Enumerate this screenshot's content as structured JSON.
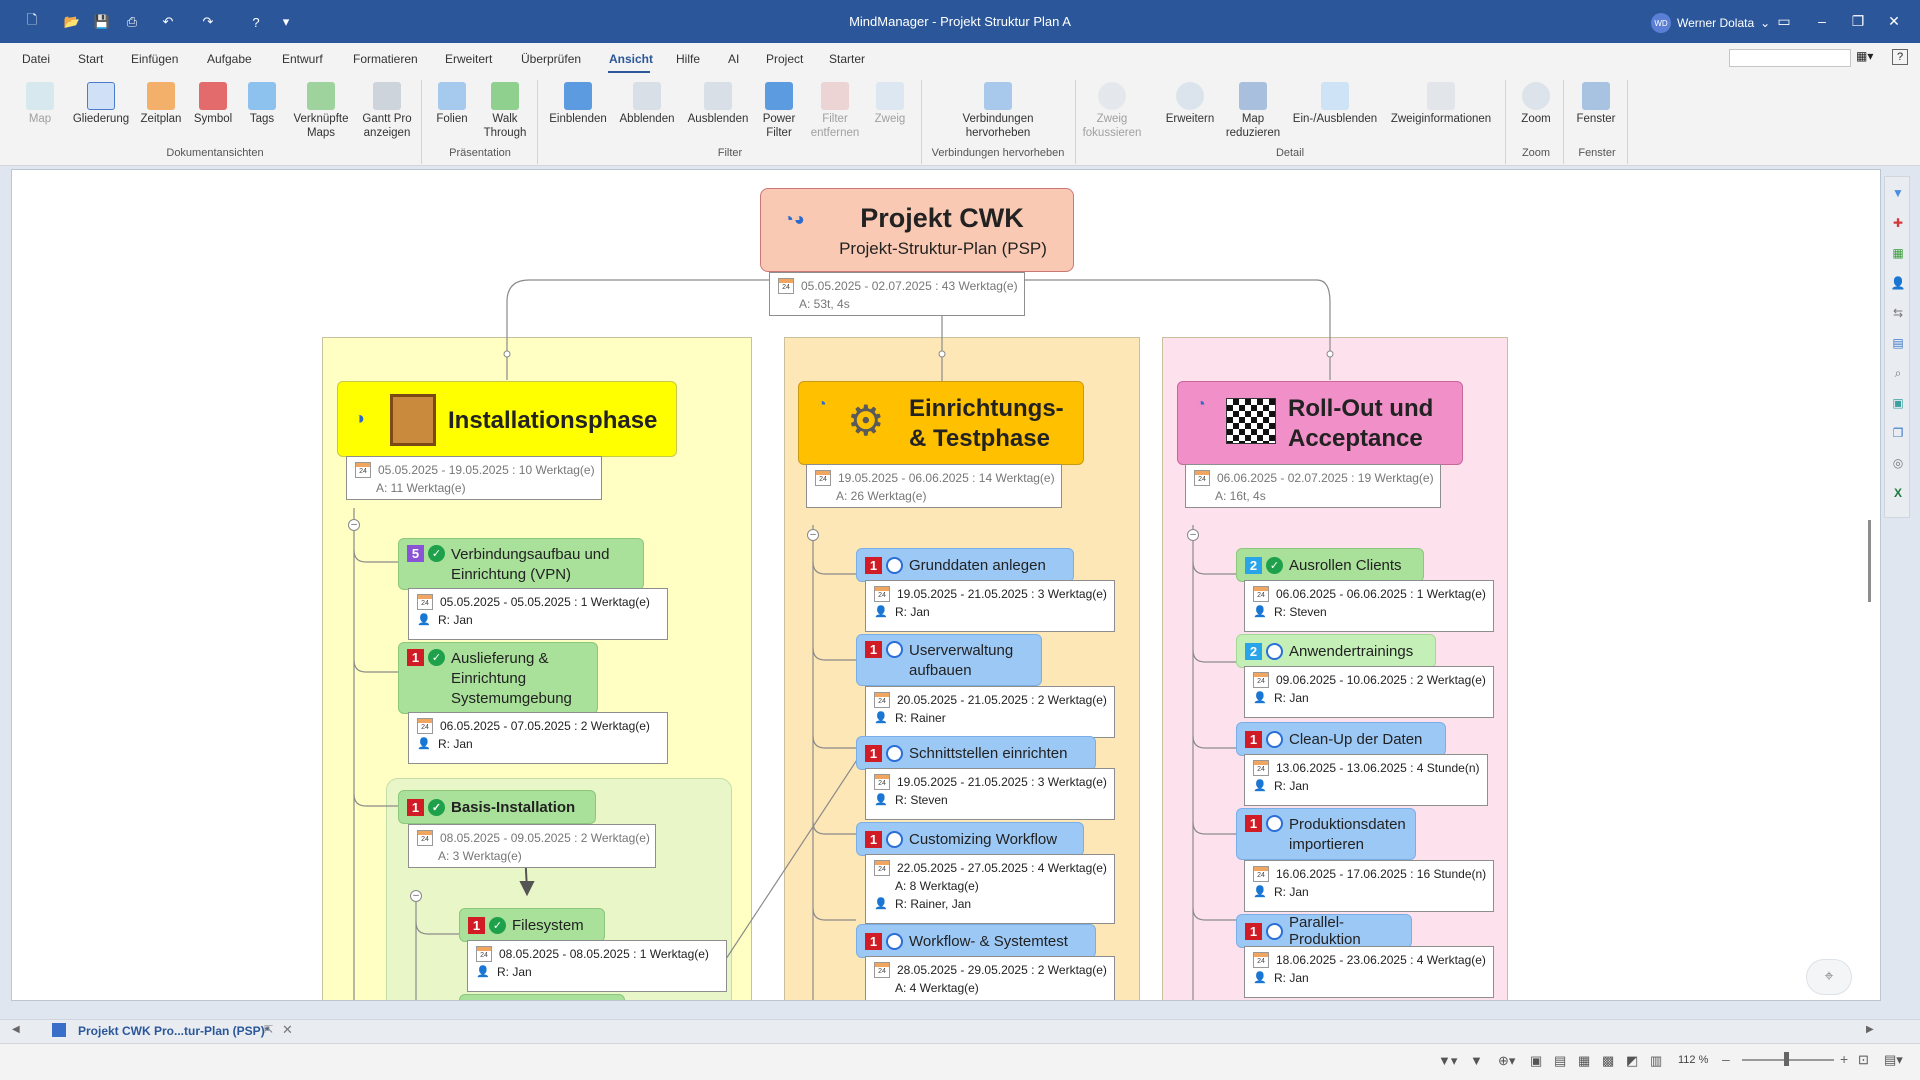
{
  "app": {
    "title": "MindManager - Projekt Struktur Plan A",
    "user": "Werner Dolata",
    "user_initials": "WD"
  },
  "menu": [
    "Datei",
    "Start",
    "Einfügen",
    "Aufgabe",
    "Entwurf",
    "Formatieren",
    "Erweitert",
    "Überprüfen",
    "Ansicht",
    "Hilfe",
    "AI",
    "Project",
    "Starter"
  ],
  "menu_active": "Ansicht",
  "ribbon": {
    "buttons": {
      "map": "Map",
      "gliederung": "Gliederung",
      "zeitplan": "Zeitplan",
      "symbol": "Symbol",
      "tags": "Tags",
      "verknuepfte": "Verknüpfte Maps",
      "gantt": "Gantt Pro anzeigen",
      "folien": "Folien",
      "walk": "Walk Through",
      "einblenden": "Einblenden",
      "abblenden": "Abblenden",
      "ausblenden": "Ausblenden",
      "power": "Power Filter",
      "filter_entfernen": "Filter entfernen",
      "zweig": "Zweig",
      "verbindungen": "Verbindungen hervorheben",
      "zweig_fokus": "Zweig fokussieren",
      "erweitern": "Erweitern",
      "map_reduzieren": "Map reduzieren",
      "ein_aus": "Ein-/Ausblenden",
      "zweiginfo": "Zweiginformationen",
      "zoom": "Zoom",
      "fenster": "Fenster"
    },
    "groups": {
      "dokumentansichten": "Dokumentansichten",
      "praesentation": "Präsentation",
      "filter": "Filter",
      "verbindungen": "Verbindungen hervorheben",
      "detail": "Detail",
      "zoom": "Zoom",
      "fenster": "Fenster"
    }
  },
  "map": {
    "root": {
      "title": "Projekt CWK",
      "subtitle": "Projekt-Struktur-Plan (PSP)",
      "dates": "05.05.2025 - 02.07.2025 : 43 Werktag(e)",
      "effort": "A: 53t, 4s"
    },
    "phases": [
      {
        "title": "Installationsphase",
        "dates": "05.05.2025 - 19.05.2025 : 10 Werktag(e)",
        "effort": "A: 11 Werktag(e)"
      },
      {
        "title_line1": "Einrichtungs-",
        "title_line2": "& Testphase",
        "dates": "19.05.2025 - 06.06.2025 : 14 Werktag(e)",
        "effort": "A: 26 Werktag(e)"
      },
      {
        "title_line1": "Roll-Out und",
        "title_line2": "Acceptance",
        "dates": "06.06.2025 - 02.07.2025 : 19 Werktag(e)",
        "effort": "A: 16t, 4s"
      }
    ],
    "tasks1": [
      {
        "prio": "5",
        "title": "Verbindungsaufbau und Einrichtung (VPN)",
        "dates": "05.05.2025 - 05.05.2025 : 1 Werktag(e)",
        "res": "R: Jan"
      },
      {
        "prio": "1",
        "title": "Auslieferung & Einrichtung Systemumgebung",
        "dates": "06.05.2025 - 07.05.2025 : 2 Werktag(e)",
        "res": "R: Jan"
      },
      {
        "prio": "1",
        "title": "Basis-Installation",
        "dates": "08.05.2025 - 09.05.2025 : 2 Werktag(e)",
        "effort": "A: 3 Werktag(e)"
      },
      {
        "prio": "1",
        "title": "Filesystem",
        "dates": "08.05.2025 - 08.05.2025 : 1 Werktag(e)",
        "res": "R: Jan"
      }
    ],
    "tasks2": [
      {
        "prio": "1",
        "title": "Grunddaten anlegen",
        "dates": "19.05.2025 - 21.05.2025 : 3 Werktag(e)",
        "res": "R: Jan"
      },
      {
        "prio": "1",
        "title": "Userverwaltung aufbauen",
        "dates": "20.05.2025 - 21.05.2025 : 2 Werktag(e)",
        "res": "R: Rainer"
      },
      {
        "prio": "1",
        "title": "Schnittstellen einrichten",
        "dates": "19.05.2025 - 21.05.2025 : 3 Werktag(e)",
        "res": "R: Steven"
      },
      {
        "prio": "1",
        "title": "Customizing Workflow",
        "dates": "22.05.2025 - 27.05.2025 : 4 Werktag(e)",
        "effort": "A: 8 Werktag(e)",
        "res": "R: Rainer, Jan"
      },
      {
        "prio": "1",
        "title": "Workflow- & Systemtest",
        "dates": "28.05.2025 - 29.05.2025 : 2 Werktag(e)",
        "effort": "A: 4 Werktag(e)"
      }
    ],
    "tasks3": [
      {
        "prio": "2",
        "title": "Ausrollen Clients",
        "dates": "06.06.2025 - 06.06.2025 : 1 Werktag(e)",
        "res": "R: Steven"
      },
      {
        "prio": "2",
        "title": "Anwendertrainings",
        "dates": "09.06.2025 - 10.06.2025 : 2 Werktag(e)",
        "res": "R: Jan"
      },
      {
        "prio": "1",
        "title": "Clean-Up der Daten",
        "dates": "13.06.2025 - 13.06.2025 : 4 Stunde(n)",
        "res": "R: Jan"
      },
      {
        "prio": "1",
        "title": "Produktionsdaten importieren",
        "dates": "16.06.2025 - 17.06.2025 : 16 Stunde(n)",
        "res": "R: Jan"
      },
      {
        "prio": "1",
        "title": "Parallel- Produktion",
        "dates": "18.06.2025 - 23.06.2025 : 4 Werktag(e)",
        "res": "R: Jan"
      }
    ]
  },
  "tab": {
    "label": "Projekt CWK Pro...tur-Plan (PSP)*"
  },
  "status": {
    "zoom": "112 %"
  },
  "colors": {
    "titlebar": "#2b579a",
    "phase1_bg": "#ffffc4",
    "phase2_bg": "#fde7b6",
    "phase3_bg": "#fde2ee",
    "root_bg": "#f9c9b4"
  }
}
